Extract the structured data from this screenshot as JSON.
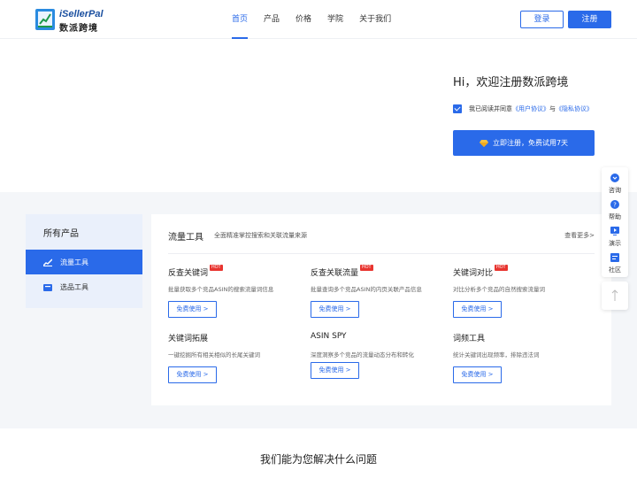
{
  "header": {
    "logo_en": "iSellerPal",
    "logo_cn": "数派跨境",
    "nav": [
      "首页",
      "产品",
      "价格",
      "学院",
      "关于我们"
    ],
    "login_label": "登录",
    "register_label": "注册"
  },
  "hero": {
    "title": "Hi，欢迎注册数派跨境",
    "agree_prefix": "我已阅读并同意",
    "user_agreement": "《用户协议》",
    "agree_and": "与",
    "privacy_agreement": "《隐私协议》",
    "cta_label": "立即注册，免费试用7天"
  },
  "products": {
    "side_title": "所有产品",
    "side_items": [
      "流量工具",
      "选品工具"
    ],
    "panel_title": "流量工具",
    "panel_sub": "全面精准掌控搜索和关联流量来源",
    "panel_more": "查看更多>",
    "hot_label": "HOT",
    "tools": [
      {
        "name": "反查关键词",
        "desc": "批量获取多个竞品ASIN的搜索流量词信息",
        "btn": "免费使用 >"
      },
      {
        "name": "反查关联流量",
        "desc": "批量查询多个竞品ASIN的内页关联产品信息",
        "btn": "免费使用 >"
      },
      {
        "name": "关键词对比",
        "desc": "对比分析多个竞品的自然搜索流量词",
        "btn": "免费使用 >"
      },
      {
        "name": "关键词拓展",
        "desc": "一键挖掘所有相关相似的长尾关键词",
        "btn": "免费使用 >"
      },
      {
        "name": "ASIN SPY",
        "desc": "深度洞察多个竞品的流量动态分布和转化",
        "btn": "免费使用 >"
      },
      {
        "name": "词频工具",
        "desc": "统计关键词出现频率，排除违法词",
        "btn": "免费使用 >"
      }
    ]
  },
  "bottom": {
    "title": "我们能为您解决什么问题"
  },
  "float_bar": {
    "items": [
      "咨询",
      "帮助",
      "演示",
      "社区"
    ]
  },
  "colors": {
    "accent": "#2a6ae9",
    "hot": "#e8342f",
    "section_bg": "#f4f6f9",
    "sidebar_bg": "#eaf0fb"
  }
}
